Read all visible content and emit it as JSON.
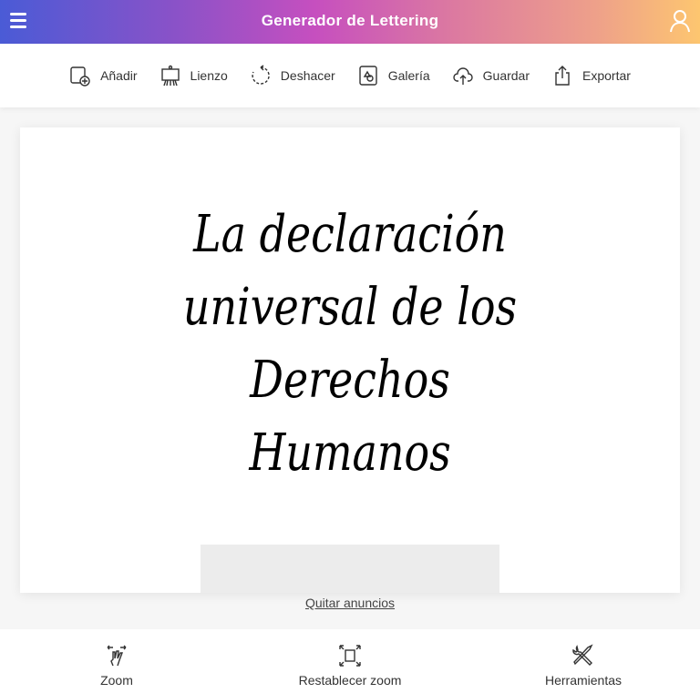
{
  "header": {
    "title": "Generador de Lettering"
  },
  "toolbar": [
    {
      "label": "Añadir",
      "icon": "add-layer-icon"
    },
    {
      "label": "Lienzo",
      "icon": "easel-icon"
    },
    {
      "label": "Deshacer",
      "icon": "undo-icon"
    },
    {
      "label": "Galería",
      "icon": "gallery-icon"
    },
    {
      "label": "Guardar",
      "icon": "cloud-upload-icon"
    },
    {
      "label": "Exportar",
      "icon": "share-icon"
    }
  ],
  "canvas": {
    "lines": [
      "La declaración",
      "universal de los",
      "Derechos",
      "Humanos"
    ]
  },
  "ads": {
    "remove_label": "Quitar anuncios"
  },
  "bottom": [
    {
      "label": "Zoom"
    },
    {
      "label": "Restablecer zoom"
    },
    {
      "label": "Herramientas"
    }
  ]
}
